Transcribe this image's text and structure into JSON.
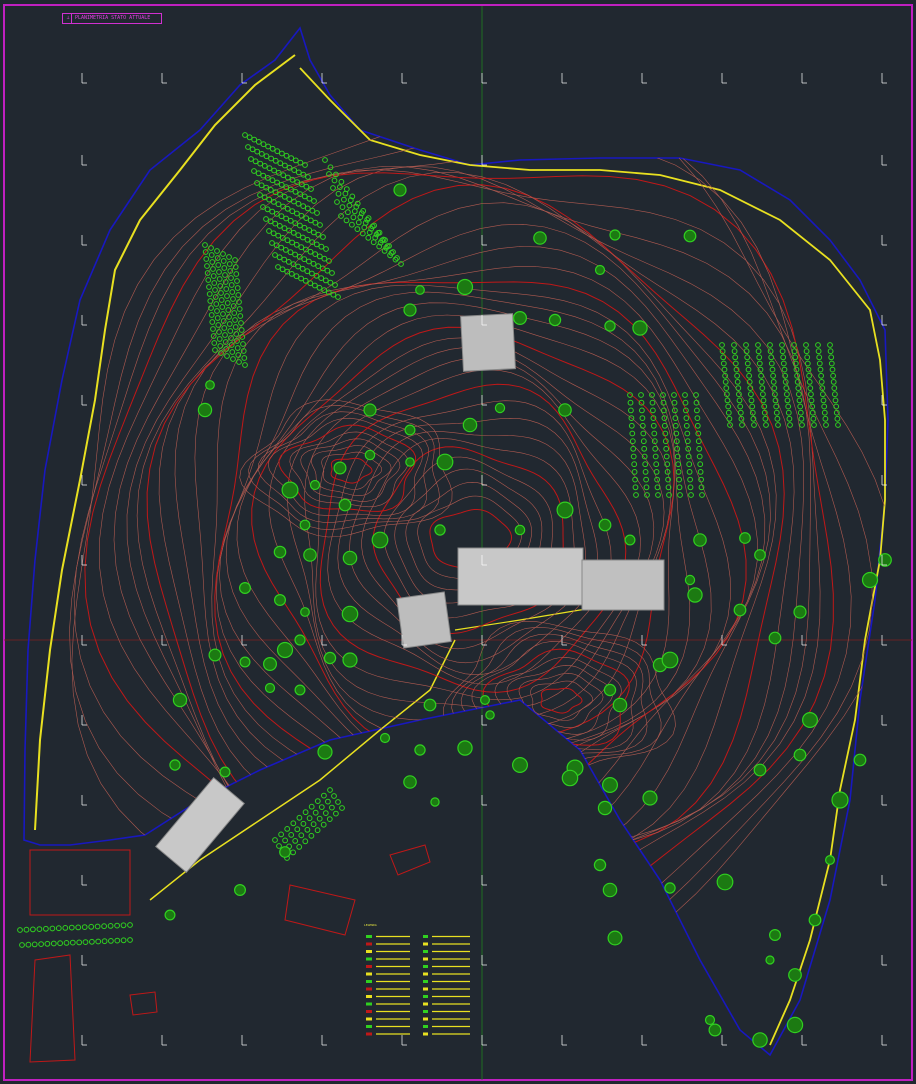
{
  "drawing": {
    "title": "PLANIMETRIA STATO ATTUALE",
    "corner_tag": "",
    "legend_title": "LEGENDA"
  },
  "colors": {
    "background": "#212830",
    "border": "#c020c0",
    "contour_minor": "#b05a50",
    "contour_major": "#c01818",
    "road_yellow": "#e8e020",
    "boundary_blue": "#1818c0",
    "vegetation": "#30d020",
    "buildings": "#c8c8c8",
    "grid_cross": "#ffffff",
    "axis_green": "#208020"
  },
  "icons": [
    "tree-icon",
    "grid-crosshair-icon",
    "north-marker-icon"
  ]
}
